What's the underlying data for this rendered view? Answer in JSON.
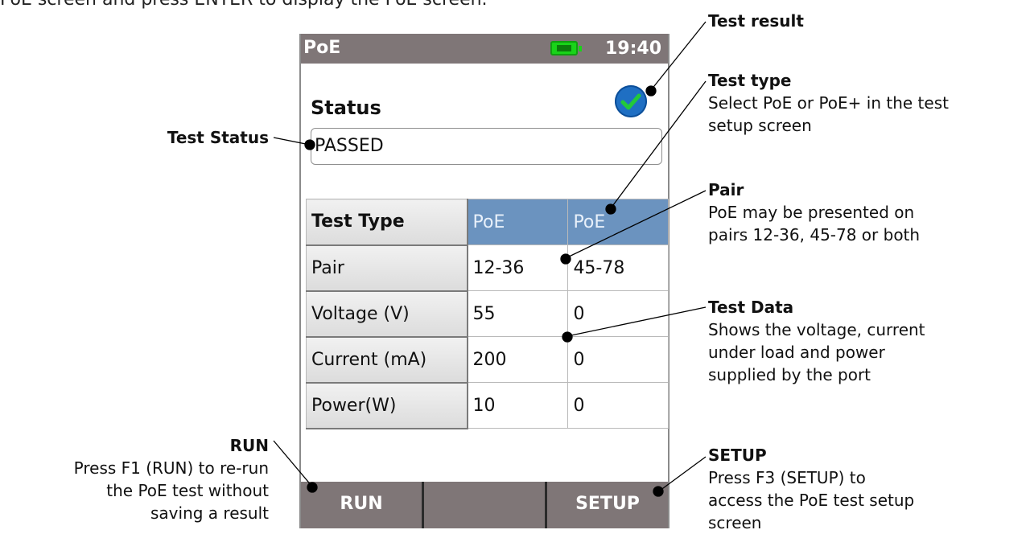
{
  "intro_text": "PoE screen and press ENTER to display the PoE screen.",
  "device": {
    "title": "PoE",
    "clock": "19:40",
    "status_label": "Status",
    "status_value": "PASSED",
    "result_icon": "check-circle-icon",
    "table": {
      "header": {
        "label": "Test Type",
        "c1": "PoE",
        "c2": "PoE"
      },
      "rows": [
        {
          "label": "Pair",
          "c1": "12-36",
          "c2": "45-78"
        },
        {
          "label": "Voltage (V)",
          "c1": "55",
          "c2": "0"
        },
        {
          "label": "Current (mA)",
          "c1": "200",
          "c2": "0"
        },
        {
          "label": "Power(W)",
          "c1": "10",
          "c2": "0"
        }
      ]
    },
    "softkeys": [
      "RUN",
      "",
      "SETUP"
    ]
  },
  "callouts": {
    "test_result": {
      "title": "Test result"
    },
    "test_type": {
      "title": "Test type",
      "text1": "Select PoE or PoE+ in the test",
      "text2": "setup screen"
    },
    "pair": {
      "title": "Pair",
      "text1": "PoE may be presented on",
      "text2": "pairs 12-36, 45-78 or both"
    },
    "test_data": {
      "title": "Test Data",
      "text1": "Shows the voltage, current",
      "text2": "under load and power",
      "text3": "supplied by the port"
    },
    "setup": {
      "title": "SETUP",
      "text1": "Press F3 (SETUP) to",
      "text2": "access the PoE test setup",
      "text3": "screen"
    },
    "test_status": {
      "title": "Test Status"
    },
    "run": {
      "title": "RUN",
      "text1": "Press F1 (RUN) to re-run",
      "text2": "the PoE test without",
      "text3": "saving a result"
    }
  },
  "colors": {
    "titlebar": "#7f7677",
    "table_header": "#6b93bf",
    "battery": "#19d319",
    "check_bg": "#1f6fc3"
  }
}
